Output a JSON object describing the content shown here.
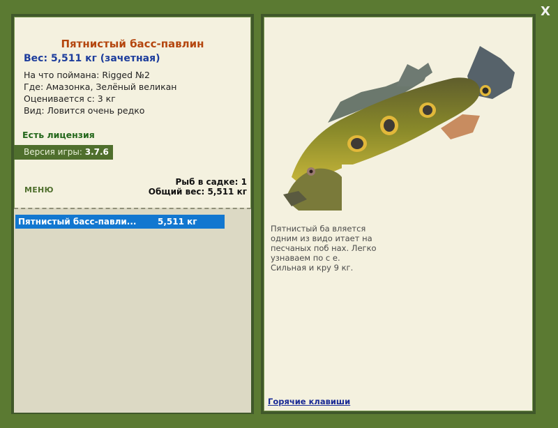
{
  "window": {
    "close_label": "X"
  },
  "fish_card": {
    "title": "Пятнистый басс-павлин",
    "weight": "Вес: 5,511 кг (зачетная)",
    "caught_with": "На что поймана: Rigged №2",
    "location": "Где: Амазонка, Зелёный великан",
    "scored_from": "Оценивается с: 3 кг",
    "rarity": "Вид: Ловится очень редко"
  },
  "license": "Есть лицензия",
  "version": {
    "label": "Версия игры:",
    "value": "3.7.6"
  },
  "menu_label": "МЕНЮ",
  "keepnet": {
    "count": "Рыб в садке: 1",
    "total_weight": "Общий вес: 5,511 кг",
    "items": [
      {
        "name": "Пятнистый басс-павли...",
        "weight": "5,511 кг"
      }
    ]
  },
  "description": {
    "lines": [
      "Пятнистый ба                                       вляется",
      "одним из видо                                     итает на",
      "песчаных поб                                      нах. Легко",
      "узнаваем по с                                     е.",
      "Сильная и кру                                      9 кг."
    ]
  },
  "hotkeys_label": "Горячие клавиши",
  "colors": {
    "frame_green": "#5b7a32",
    "panel_bg": "#f4f1df",
    "title_orange": "#b4460e",
    "weight_blue": "#1d3d9c",
    "selected_row": "#1277d0"
  }
}
